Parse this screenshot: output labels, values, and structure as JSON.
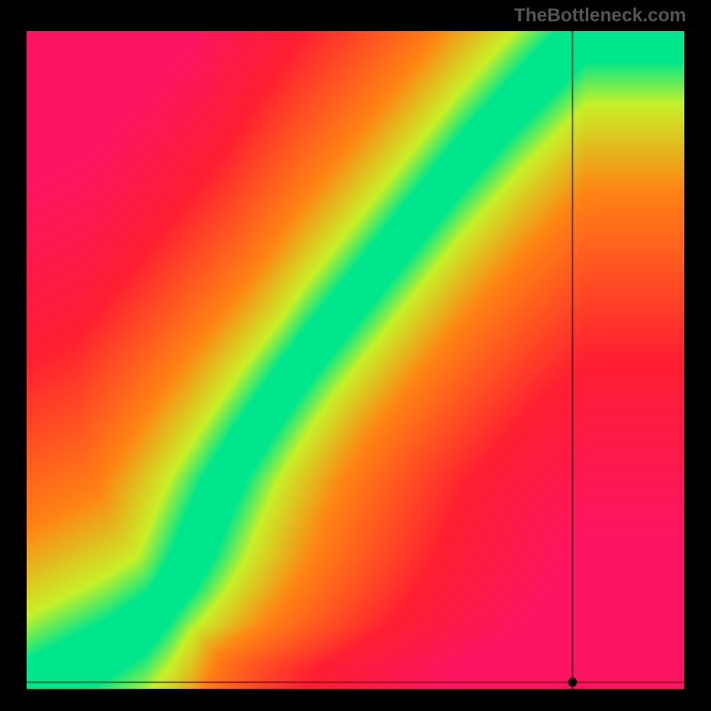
{
  "watermark": "TheBottleneck.com",
  "chart_data": {
    "type": "heatmap",
    "title": "",
    "xlabel": "",
    "ylabel": "",
    "xlim": [
      0,
      100
    ],
    "ylim": [
      0,
      100
    ],
    "marker": {
      "x": 83,
      "y": 1
    },
    "crosshair": {
      "x": 83,
      "y": 1
    },
    "optimal_curve_description": "Green optimal band curves from bottom-left origin, bows right through lower region, then rises in a near-linear steep path toward upper-right; colors grade green->yellow->orange->red with distance from band",
    "optimal_curve_points": [
      {
        "x": 0,
        "y": 0
      },
      {
        "x": 6,
        "y": 3
      },
      {
        "x": 12,
        "y": 6
      },
      {
        "x": 18,
        "y": 10
      },
      {
        "x": 22,
        "y": 15
      },
      {
        "x": 25,
        "y": 20
      },
      {
        "x": 27,
        "y": 25
      },
      {
        "x": 30,
        "y": 32
      },
      {
        "x": 35,
        "y": 40
      },
      {
        "x": 42,
        "y": 50
      },
      {
        "x": 50,
        "y": 60
      },
      {
        "x": 58,
        "y": 70
      },
      {
        "x": 66,
        "y": 80
      },
      {
        "x": 75,
        "y": 90
      },
      {
        "x": 85,
        "y": 100
      }
    ]
  }
}
